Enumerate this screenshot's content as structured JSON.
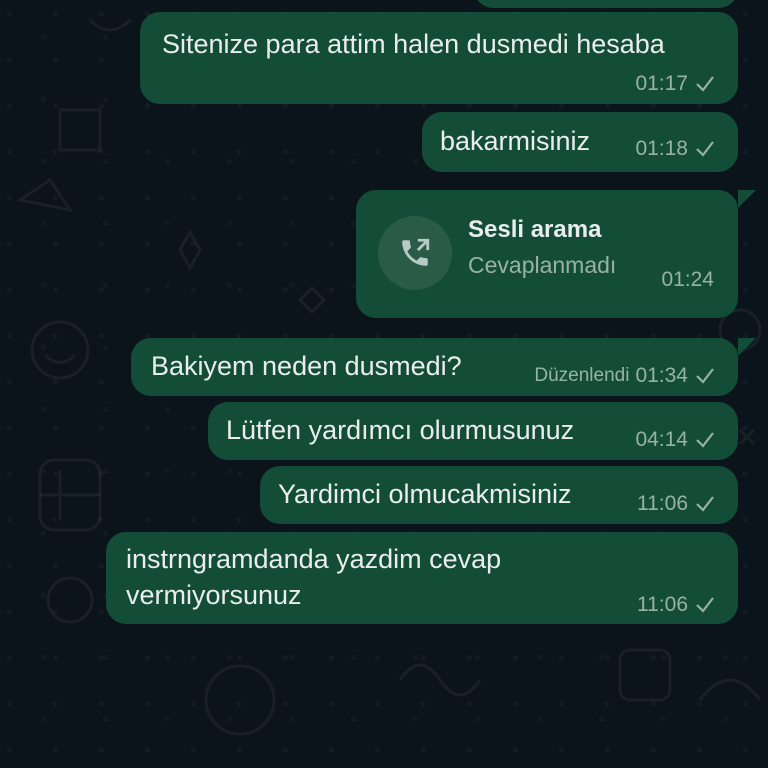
{
  "messages": [
    {
      "text": "Sitenize para attim halen dusmedi hesaba",
      "time": "01:17"
    },
    {
      "text": "bakarmisiniz",
      "time": "01:18"
    },
    {
      "text": "Bakiyem neden dusmedi?",
      "edited": "Düzenlendi",
      "time": "01:34"
    },
    {
      "text": "Lütfen yardımcı olurmusunuz",
      "time": "04:14"
    },
    {
      "text": "Yardimci olmucakmisiniz",
      "time": "11:06"
    },
    {
      "text_line1": "instrngramdanda yazdim cevap",
      "text_line2": "vermiyorsunuz",
      "time": "11:06"
    }
  ],
  "call": {
    "title": "Sesli arama",
    "status": "Cevaplanmadı",
    "time": "01:24"
  },
  "icons": {
    "read_status": "single-check-icon",
    "call": "outgoing-call-icon"
  },
  "colors": {
    "background": "#0b141a",
    "bubble": "#144d37",
    "text": "#e9edef"
  }
}
